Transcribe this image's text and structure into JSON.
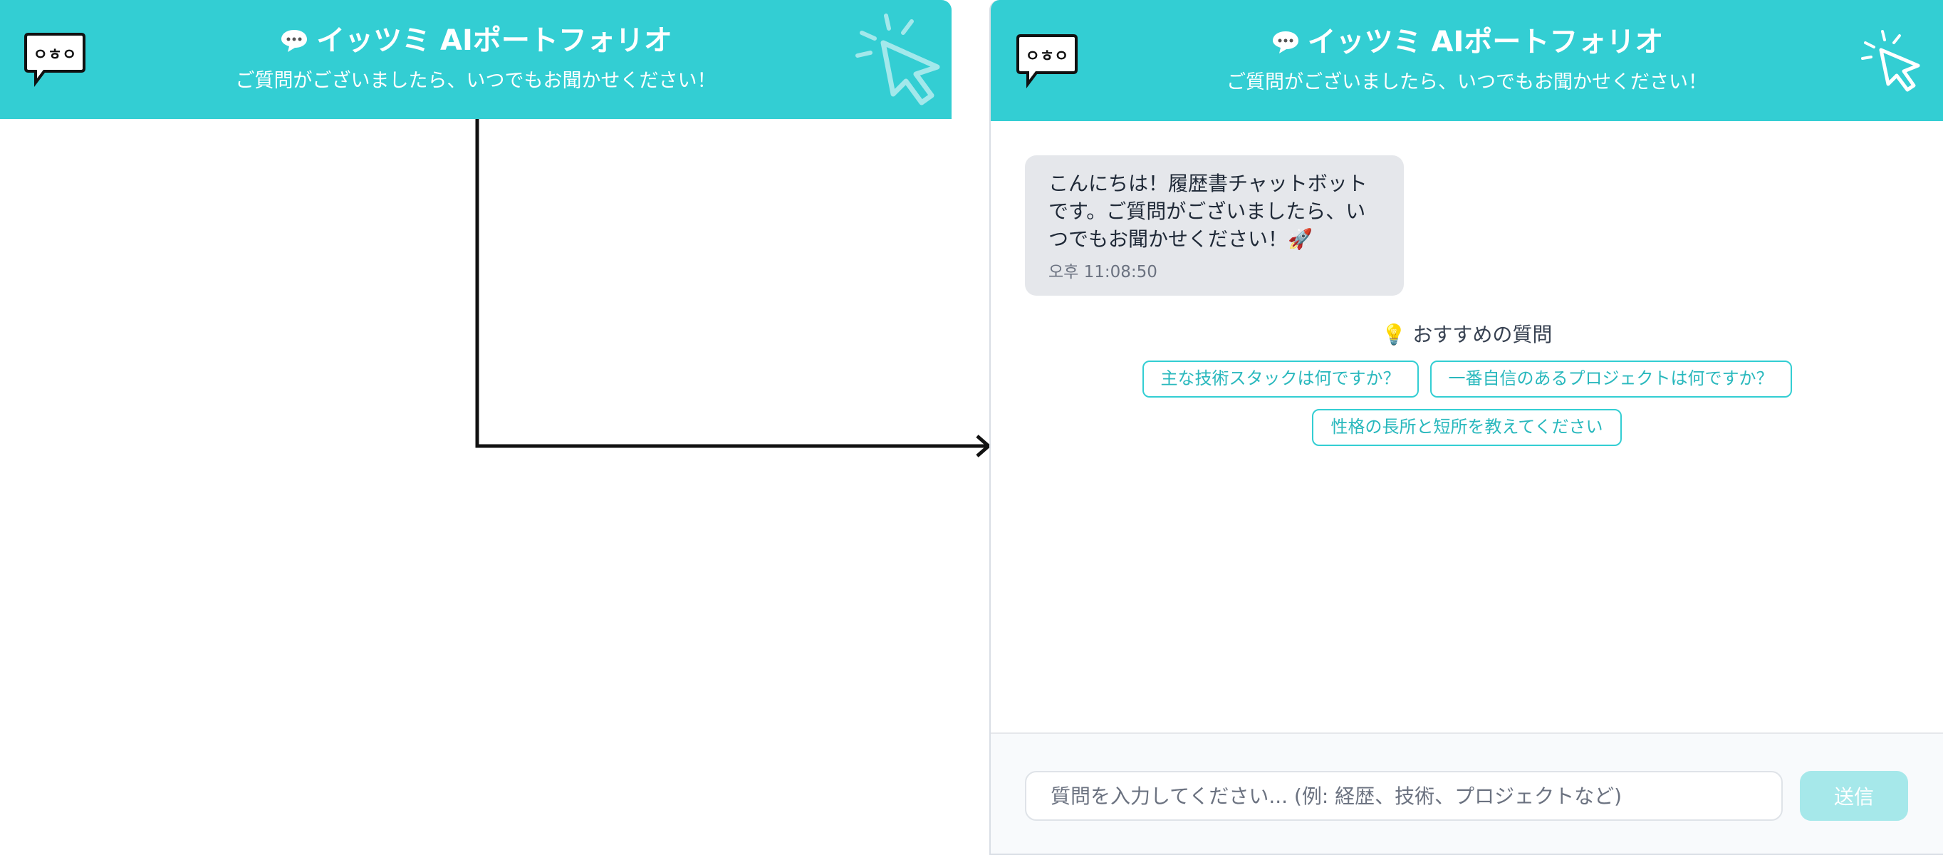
{
  "header": {
    "title": "イッツミ AIポートフォリオ",
    "subtitle": "ご質問がございましたら、いつでもお聞かせください！",
    "logo_text": "ㅇㅎㅇ",
    "title_icon": "speech-bubble-icon",
    "deco_icon": "click-cursor-icon"
  },
  "chat": {
    "messages": [
      {
        "text": "こんにちは！履歴書チャットボットです。ご質問がございましたら、いつでもお聞かせください！🚀",
        "time": "오후 11:08:50"
      }
    ],
    "suggestions_title": "💡 おすすめの質問",
    "suggestions": [
      "主な技術スタックは何ですか？",
      "一番自信のあるプロジェクトは何ですか？",
      "性格の長所と短所を教えてください"
    ]
  },
  "input": {
    "placeholder": "質問を入力してください... (例: 経歴、技術、プロジェクトなど)",
    "value": "",
    "send_label": "送信"
  },
  "colors": {
    "brand": "#33ced3",
    "send_disabled": "#a6e8ea",
    "bubble_bg": "#e5e7eb"
  }
}
